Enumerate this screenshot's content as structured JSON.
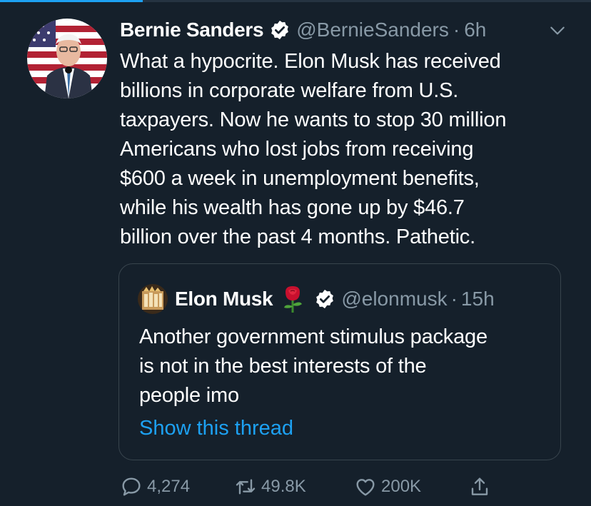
{
  "tweet": {
    "author_name": "Bernie Sanders",
    "handle": "@BernieSanders",
    "separator": "·",
    "time": "6h",
    "lines": [
      "What a hypocrite. Elon Musk has received",
      "billions in corporate welfare from U.S.",
      "taxpayers. Now he wants to stop 30 million",
      "Americans who lost jobs from receiving",
      "$600 a week in unemployment benefits,",
      "while his wealth has gone up by $46.7",
      "billion over the past 4 months. Pathetic."
    ]
  },
  "quote": {
    "author_name": "Elon Musk",
    "handle": "@elonmusk",
    "separator": "·",
    "time": "15h",
    "lines": [
      "Another government stimulus package",
      "is not in the best interests of the",
      "people imo"
    ],
    "thread_link": "Show this thread"
  },
  "actions": {
    "replies": "4,274",
    "retweets": "49.8K",
    "likes": "200K"
  },
  "icons": {
    "verified": "verified-badge-icon",
    "chevron": "chevron-down-icon",
    "rose": "rose-emoji-icon",
    "reply": "reply-icon",
    "retweet": "retweet-icon",
    "like": "heart-icon",
    "share": "share-icon"
  },
  "colors": {
    "background": "#15202b",
    "secondary_text": "#8899a6",
    "link": "#1da1f2",
    "border": "#38444d"
  }
}
